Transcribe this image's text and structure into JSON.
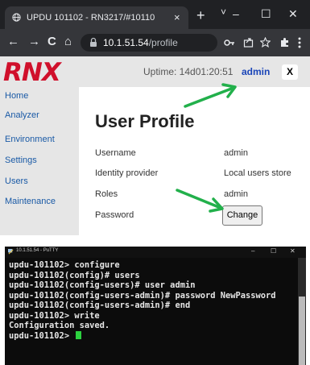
{
  "browser": {
    "tab_title": "UPDU 101102 - RN3217/#10110",
    "tab_close": "×",
    "new_tab": "+",
    "tab_menu": "˅",
    "minimize": "–",
    "maximize": "☐",
    "close": "✕",
    "back": "←",
    "forward": "→",
    "reload": "C",
    "home": "⌂",
    "url_host": "10.1.51.54",
    "url_path": "/profile",
    "toolbar_icons": [
      "key-icon",
      "share-icon",
      "star-icon",
      "extensions-icon",
      "menu-icon"
    ]
  },
  "site": {
    "logo": "RNX",
    "uptime": "Uptime: 14d01:20:51",
    "user": "admin",
    "logout": "X",
    "accent_color": "#d0102b",
    "link_color": "#1a5aa6"
  },
  "sidebar": {
    "items": [
      {
        "label": "Home"
      },
      {
        "label": "Analyzer"
      },
      {
        "label": "Environment"
      },
      {
        "label": "Settings"
      },
      {
        "label": "Users"
      },
      {
        "label": "Maintenance"
      }
    ]
  },
  "profile": {
    "title": "User Profile",
    "fields": [
      {
        "label": "Username",
        "value": "admin"
      },
      {
        "label": "Identity provider",
        "value": "Local users store"
      },
      {
        "label": "Roles",
        "value": "admin"
      },
      {
        "label": "Password",
        "value": ""
      }
    ],
    "change_button": "Change"
  },
  "annotations": {
    "arrow_color": "#22b04b"
  },
  "terminal": {
    "title": "10.1.51.54 - PuTTY",
    "minimize": "–",
    "maximize": "☐",
    "close": "✕",
    "lines": [
      "updu-101102> configure",
      "updu-101102(config)# users",
      "updu-101102(config-users)# user admin",
      "updu-101102(config-users-admin)# password NewPassword",
      "updu-101102(config-users-admin)# end",
      "updu-101102> write",
      "Configuration saved.",
      "updu-101102> "
    ],
    "cursor_color": "#2cd13f"
  }
}
